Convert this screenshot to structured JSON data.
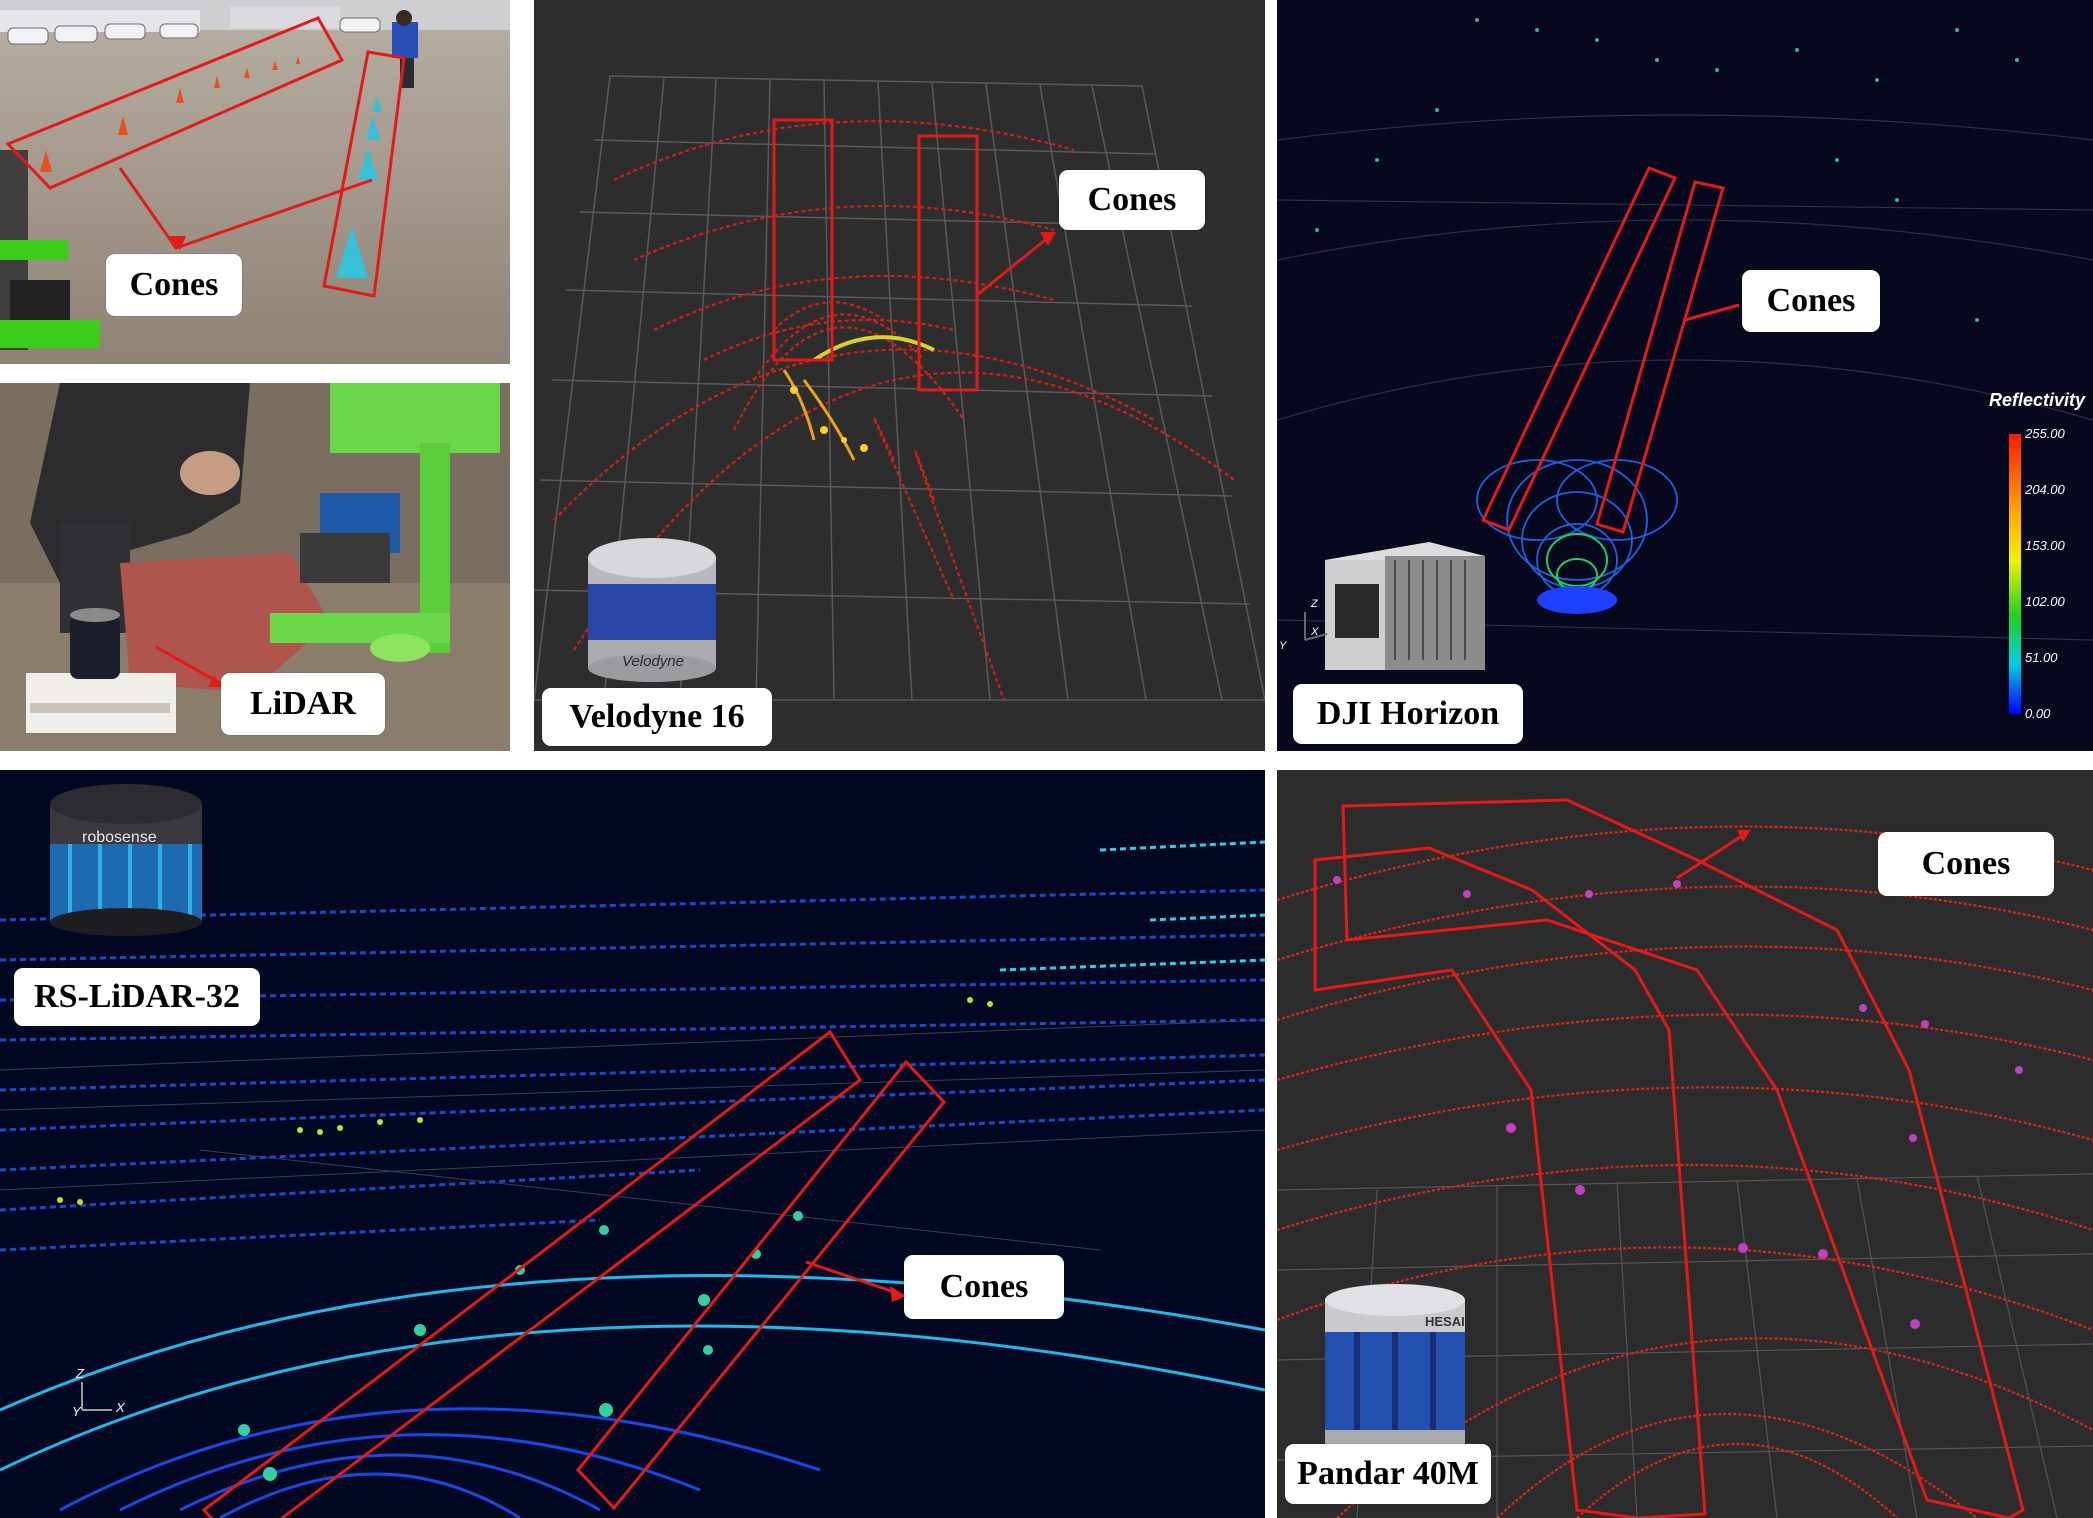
{
  "photo_scene": {
    "cones_label": "Cones"
  },
  "photo_setup": {
    "lidar_label": "LiDAR"
  },
  "velodyne_panel": {
    "sensor_label": "Velodyne 16",
    "cones_label": "Cones",
    "device_brand_text": "Velodyne",
    "point_color": "#e0201c",
    "background": "#2d2d2d"
  },
  "dji_panel": {
    "sensor_label": "DJI Horizon",
    "cones_label": "Cones",
    "legend": {
      "title": "Reflectivity",
      "ticks": [
        "255.00",
        "204.00",
        "153.00",
        "102.00",
        "51.00",
        "0.00"
      ]
    },
    "axes": {
      "z": "Z",
      "x": "X",
      "y": "Y"
    },
    "background": "#06081e"
  },
  "robosense_panel": {
    "sensor_label": "RS-LiDAR-32",
    "cones_label": "Cones",
    "device_brand_text": "robosense",
    "axes": {
      "z": "Z",
      "y": "Y",
      "x": "X"
    },
    "background": "#020822"
  },
  "pandar_panel": {
    "sensor_label": "Pandar 40M",
    "cones_label": "Cones",
    "device_brand_text": "HESAI",
    "background": "#2c2c2c"
  },
  "annotation_color": "#e41a1a"
}
